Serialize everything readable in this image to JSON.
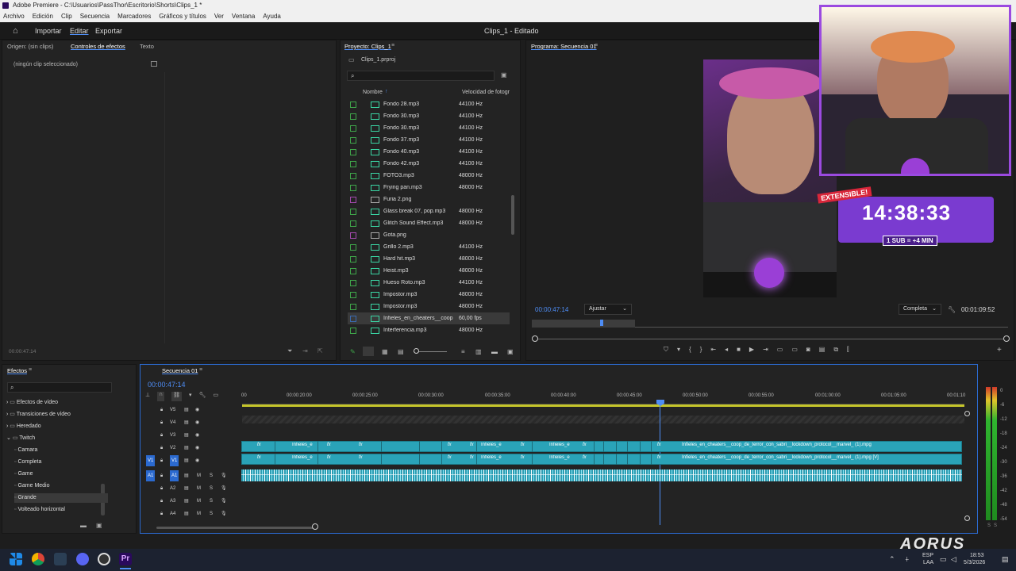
{
  "title": "Adobe Premiere - C:\\Usuarios\\PassThor\\Escritorio\\Shorts\\Clips_1 *",
  "menu": [
    "Archivo",
    "Edición",
    "Clip",
    "Secuencia",
    "Marcadores",
    "Gráficos y títulos",
    "Ver",
    "Ventana",
    "Ayuda"
  ],
  "workspace": {
    "import": "Importar",
    "edit": "Editar",
    "export": "Exportar",
    "doc_title": "Clips_1 - Editado"
  },
  "source_panel": {
    "tab_origin": "Origen: (sin clips)",
    "tab_effects": "Controles de efectos",
    "tab_text": "Texto",
    "empty": "(ningún clip seleccionado)",
    "timecode": "00:00:47:14"
  },
  "project": {
    "tab": "Proyecto: Clips_1",
    "file": "Clips_1.prproj",
    "col_name": "Nombre",
    "col_rate": "Velocidad de fotogr",
    "items": [
      {
        "name": "Fondo 28.mp3",
        "rate": "44100 Hz",
        "type": "audio"
      },
      {
        "name": "Fondo 30.mp3",
        "rate": "44100 Hz",
        "type": "audio"
      },
      {
        "name": "Fondo 30.mp3",
        "rate": "44100 Hz",
        "type": "audio"
      },
      {
        "name": "Fondo 37.mp3",
        "rate": "44100 Hz",
        "type": "audio"
      },
      {
        "name": "Fondo 40.mp3",
        "rate": "44100 Hz",
        "type": "audio"
      },
      {
        "name": "Fondo 42.mp3",
        "rate": "44100 Hz",
        "type": "audio"
      },
      {
        "name": "FOTO3.mp3",
        "rate": "48000 Hz",
        "type": "audio"
      },
      {
        "name": "Frying pan.mp3",
        "rate": "48000 Hz",
        "type": "audio"
      },
      {
        "name": "Furia 2.png",
        "rate": "",
        "type": "image"
      },
      {
        "name": "Glass break 07, pop.mp3",
        "rate": "48000 Hz",
        "type": "audio"
      },
      {
        "name": "Glitch Sound Effect.mp3",
        "rate": "48000 Hz",
        "type": "audio"
      },
      {
        "name": "Gota.png",
        "rate": "",
        "type": "image"
      },
      {
        "name": "Grillo 2.mp3",
        "rate": "44100 Hz",
        "type": "audio"
      },
      {
        "name": "Hard hit.mp3",
        "rate": "48000 Hz",
        "type": "audio"
      },
      {
        "name": "Heist.mp3",
        "rate": "48000 Hz",
        "type": "audio"
      },
      {
        "name": "Hueso Roto.mp3",
        "rate": "44100 Hz",
        "type": "audio"
      },
      {
        "name": "Impostor.mp3",
        "rate": "48000 Hz",
        "type": "audio"
      },
      {
        "name": "Impostor.mp3",
        "rate": "48000 Hz",
        "type": "audio"
      },
      {
        "name": "Infieles_en_cheaters__coop",
        "rate": "60,00 fps",
        "type": "video"
      },
      {
        "name": "Interferencia.mp3",
        "rate": "48000 Hz",
        "type": "audio"
      }
    ]
  },
  "program": {
    "tab": "Programa: Secuencia 01",
    "timecode": "00:00:47:14",
    "fit": "Ajustar",
    "quality": "Completa",
    "duration": "00:01:09:52",
    "overlay": {
      "badge": "EXTENSIBLE!",
      "timer": "14:38:33",
      "sub": "1 SUB = +4 MIN"
    }
  },
  "effects": {
    "tab": "Efectos",
    "items": [
      {
        "label": "Efectos de vídeo",
        "level": 0,
        "folder": true
      },
      {
        "label": "Transiciones de vídeo",
        "level": 0,
        "folder": true
      },
      {
        "label": "Heredado",
        "level": 0,
        "folder": true
      },
      {
        "label": "Twitch",
        "level": 0,
        "folder": true
      },
      {
        "label": "Camara",
        "level": 1
      },
      {
        "label": "Completa",
        "level": 1
      },
      {
        "label": "Game",
        "level": 1
      },
      {
        "label": "Game Medio",
        "level": 1
      },
      {
        "label": "Grande",
        "level": 1
      },
      {
        "label": "Volteado horizontal",
        "level": 1
      }
    ]
  },
  "timeline": {
    "tab": "Secuencia 01",
    "timecode": "00:00:47:14",
    "ruler": [
      "00",
      "00:00:20:00",
      "00:00:25:00",
      "00:00:30:00",
      "00:00:35:00",
      "00:00:40:00",
      "00:00:45:00",
      "00:00:50:00",
      "00:00:55:00",
      "00:01:00:00",
      "00:01:05:00",
      "00:01:10"
    ],
    "video_tracks": [
      "V5",
      "V4",
      "V3",
      "V2",
      "V1"
    ],
    "audio_tracks": [
      "A1",
      "A2",
      "A3",
      "A4"
    ],
    "clip_v2": "Infieles_en_cheaters__coop_de_terror_con_sabri__lockdown_protocol__marvel_ (1).mpg",
    "clip_v1": "Infieles_en_cheaters__coop_de_terror_con_sabri__lockdown_protocol__marvel_ (1).mpg [V]",
    "short_clip": "Infieles_e",
    "fx": "fx",
    "meter_labels": [
      "0",
      "-6",
      "-12",
      "-18",
      "-24",
      "-30",
      "-36",
      "-42",
      "-48",
      "-54"
    ]
  },
  "taskbar": {
    "lang": "ESP",
    "region": "LAA",
    "time": "18:53",
    "date": "5/3/2026"
  },
  "logo": "AORUS"
}
